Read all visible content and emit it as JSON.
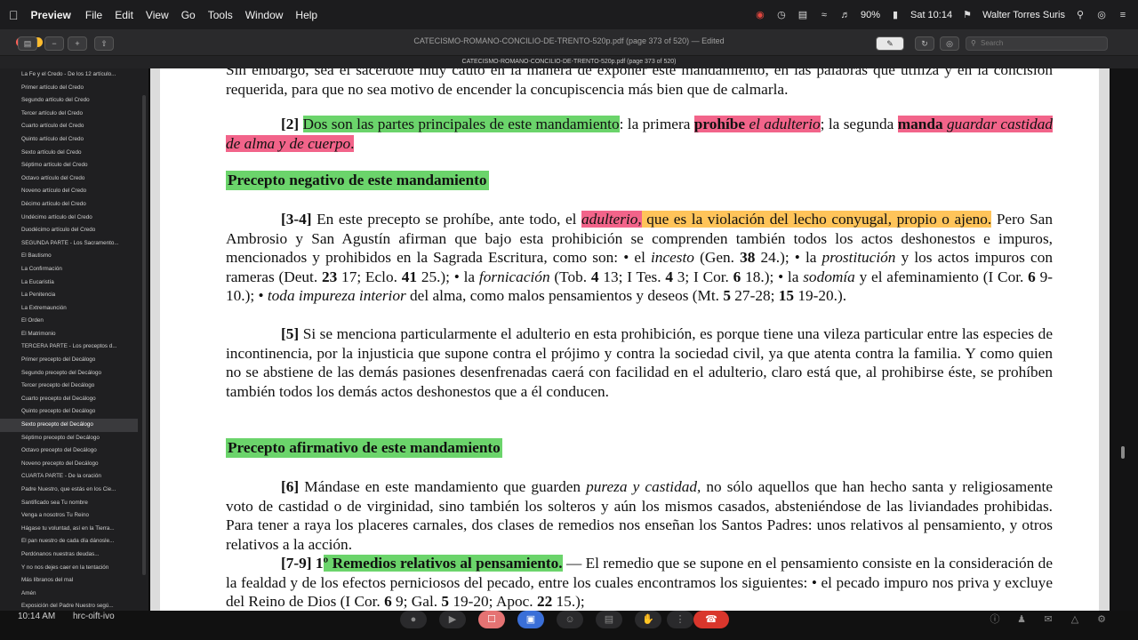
{
  "menubar": {
    "app_name": "Preview",
    "items": [
      "File",
      "Edit",
      "View",
      "Go",
      "Tools",
      "Window",
      "Help"
    ],
    "battery": "90%",
    "clock": "Sat 10:14",
    "user": "Walter Torres Suris"
  },
  "window": {
    "title": "CATECISMO-ROMANO-CONCILIO-DE-TRENTO-520p.pdf (page 373 of 520)",
    "edited": "Edited",
    "page_header": "CATECISMO-ROMANO-CONCILIO-DE-TRENTO-520p.pdf (page 373 of 520)",
    "search_placeholder": "Search"
  },
  "sidebar": {
    "items": [
      "La Fe y el Credo - De los 12 artículo...",
      "Primer artículo del Credo",
      "Segundo artículo del Credo",
      "Tercer artículo del Credo",
      "Cuarto artículo del Credo",
      "Quinto artículo del Credo",
      "Sexto artículo del Credo",
      "Séptimo artículo del Credo",
      "Octavo artículo del Credo",
      "Noveno artículo del Credo",
      "Décimo artículo del Credo",
      "Undécimo artículo del Credo",
      "Duodécimo artículo del Credo",
      "SEGUNDA PARTE - Los Sacramento...",
      "El Bautismo",
      "La Confirmación",
      "La Eucaristía",
      "La Penitencia",
      "La Extremaunción",
      "El Orden",
      "El Matrimonio",
      "TERCERA PARTE - Los preceptos d...",
      "Primer precepto del Decálogo",
      "Segundo precepto del Decálogo",
      "Tercer precepto del Decálogo",
      "Cuarto precepto del Decálogo",
      "Quinto precepto del Decálogo",
      "Sexto precepto del Decálogo",
      "Séptimo precepto del Decálogo",
      "Octavo precepto del Decálogo",
      "Noveno precepto del Decálogo",
      "CUARTA PARTE - De la oración",
      "Padre Nuestro, que estás en los Cie...",
      "Santificado sea Tu nombre",
      "Venga a nosotros Tu Reino",
      "Hágase tu voluntad, así en la Tierra...",
      "El pan nuestro de cada día dánosle...",
      "Perdónanos nuestras deudas...",
      "Y no nos dejes caer en la tentación",
      "Más líbranos del mal",
      "Amén",
      "Exposición del Padre Nuestro segú..."
    ],
    "selected_index": 27
  },
  "document": {
    "intro_line1": "Sin embargo, sea el sacerdote muy cauto en la manera de exponer este mandamiento, en las palabras",
    "intro_line2": "que utiliza y en la concisión requerida, para que no sea motivo de encender la concupiscencia más bien que de calmarla.",
    "p2_num": "[2]",
    "p2_hl": "Dos son las partes principales de este mandamiento",
    "p2_mid": ": la primera ",
    "p2_prohibe": "prohíbe",
    "p2_adulterio": "el adulterio",
    "p2_segunda": "; la segunda",
    "p2_manda": "manda",
    "p2_guardar": "guardar castidad de alma y de cuerpo",
    "p2_end": ".",
    "heading_negative": "Precepto negativo de este mandamiento",
    "p34_num": "[3-4]",
    "p34_a": " En este precepto se prohíbe, ante todo, el ",
    "p34_adulterio": "adulterio,",
    "p34_def": " que es la violación del lecho conyugal, propio o ajeno.",
    "p34_b": " Pero San Ambrosio y San Agustín afirman que bajo esta prohibición se comprenden también todos los actos deshonestos e impuros, mencionados y prohibidos en la Sagrada Escritura, como son: • el ",
    "p34_incesto": "incesto",
    "p34_c": " (Gen. ",
    "p34_38": "38",
    "p34_d": " 24.); • la ",
    "p34_prost": "prostitución",
    "p34_e": " y los actos impuros con rameras (Deut. ",
    "p34_23": "23",
    "p34_f": " 17; Eclo. ",
    "p34_41": "41",
    "p34_g": " 25.); • la ",
    "p34_forn": "fornicación",
    "p34_h": " (Tob. ",
    "p34_4a": "4",
    "p34_i": " 13; I Tes. ",
    "p34_4b": "4",
    "p34_j": " 3; I Cor. ",
    "p34_6a": "6",
    "p34_k": " 18.); • la ",
    "p34_sodo": "sodomía",
    "p34_l": " y el afeminamiento (I Cor. ",
    "p34_6b": "6",
    "p34_m": " 9-10.); • ",
    "p34_toda": "toda impureza interior",
    "p34_n": " del alma, como malos pensamientos y deseos (Mt. ",
    "p34_5": "5",
    "p34_o": " 27-28; ",
    "p34_15": "15",
    "p34_p": " 19-20.).",
    "p5_num": "[5]",
    "p5_text": " Si se menciona particularmente el adulterio en esta prohibición, es porque tiene una vileza particular entre las especies de incontinencia, por la injusticia que supone contra el prójimo y contra la sociedad civil, ya que atenta contra la familia. Y como quien no se abstiene de las demás pasiones desenfrenadas caerá con facilidad en el adulterio, claro está que, al prohibirse éste, se prohíben también todos los demás actos deshonestos que a él conducen.",
    "heading_positive": "Precepto afirmativo de este mandamiento",
    "p6_num": "[6]",
    "p6_a": " Mándase en este mandamiento que guarden ",
    "p6_pureza": "pureza y castidad,",
    "p6_b": " no sólo aquellos que han hecho santa y religiosamente voto de castidad o de virginidad, sino también los solteros y aún los mismos casados, absteniéndose de las liviandades prohibidas. Para tener a raya los placeres carnales, dos clases de remedios nos enseñan los Santos Padres: unos relativos al pensamiento, y otros relativos a la acción.",
    "p79_num": "[7-9]",
    "p79_one": " 1",
    "p79_hl": "º Remedios relativos al pensamiento.",
    "p79_a": " — El remedio que se supone en el pensamiento consiste en la consideración de la fealdad y de los efectos perniciosos del pecado, entre los cuales encontramos los siguientes: • el pecado impuro nos priva y excluye del Reino de Dios (I Cor. ",
    "p79_6": "6",
    "p79_b": " 9; Gal. ",
    "p79_5": "5",
    "p79_c": " 19-20; Apoc. ",
    "p79_22": "22",
    "p79_d": " 15.);"
  },
  "bottombar": {
    "time": "10:14 AM",
    "meeting_code": "hrc-oift-ivo"
  },
  "colors": {
    "highlight_green": "#6bd46b",
    "highlight_pink": "#f2648a",
    "highlight_orange": "#ffc45a",
    "hangup_red": "#d9362c"
  }
}
